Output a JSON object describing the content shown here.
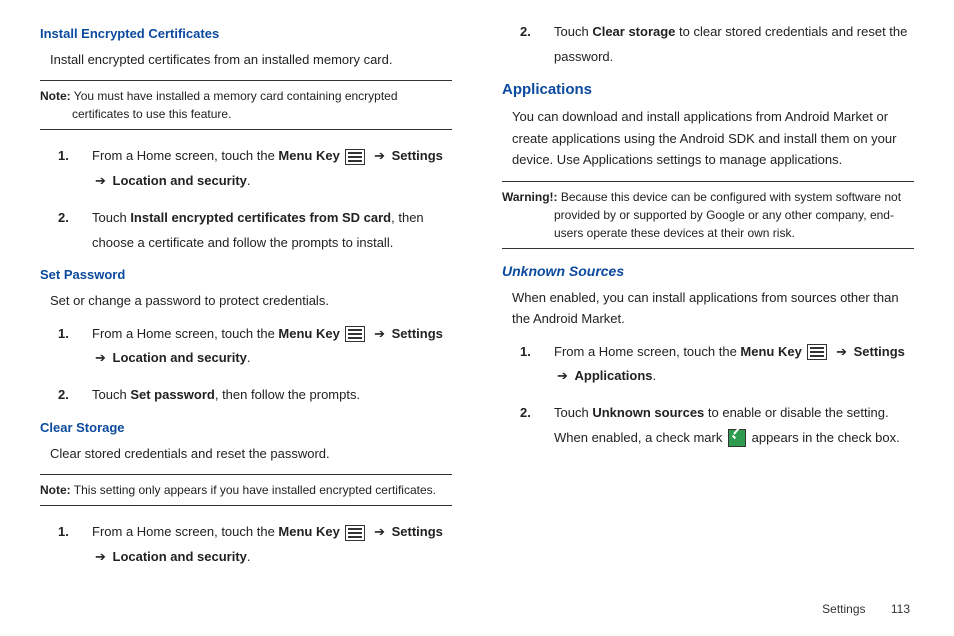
{
  "left": {
    "sec1": {
      "title": "Install Encrypted Certificates",
      "body": "Install encrypted certificates from an installed memory card.",
      "note_label": "Note:",
      "note": " You must have installed a memory card containing encrypted certificates to use this feature.",
      "step1_pre": "From a Home screen, touch the ",
      "menu_key": "Menu Key",
      "arrow": " ➔ ",
      "settings": "Settings",
      "location_security": "Location and security",
      "period": ".",
      "step2_a": "Touch ",
      "step2_b": "Install encrypted certificates from SD card",
      "step2_c": ", then choose a certificate and follow the prompts to install."
    },
    "sec2": {
      "title": "Set Password",
      "body": "Set or change a password to protect credentials.",
      "step2_a": "Touch ",
      "step2_b": "Set password",
      "step2_c": ", then follow the prompts."
    },
    "sec3": {
      "title": "Clear Storage",
      "body": "Clear stored credentials and reset the password.",
      "note_label": "Note:",
      "note": " This setting only appears if you have installed encrypted certificates."
    }
  },
  "right": {
    "top_step2_a": "Touch ",
    "top_step2_b": "Clear storage",
    "top_step2_c": " to clear stored credentials and reset the password.",
    "apps_title": "Applications",
    "apps_body": "You can download and install applications from Android Market or create applications using the Android SDK and install them on your device. Use Applications settings to manage applications.",
    "warn_label": "Warning!:",
    "warn": " Because this device can be configured with system software not provided by or supported by Google or any other company, end-users operate these devices at their own risk.",
    "unknown_title": "Unknown Sources",
    "unknown_body": "When enabled, you can install applications from sources other than the Android Market.",
    "applications": "Applications",
    "step2_a": "Touch ",
    "step2_b": "Unknown sources",
    "step2_c": " to enable or disable the setting. When enabled, a check mark ",
    "step2_d": " appears in the check box."
  },
  "nums": {
    "n1": "1.",
    "n2": "2."
  },
  "footer": {
    "section": "Settings",
    "page": "113"
  }
}
